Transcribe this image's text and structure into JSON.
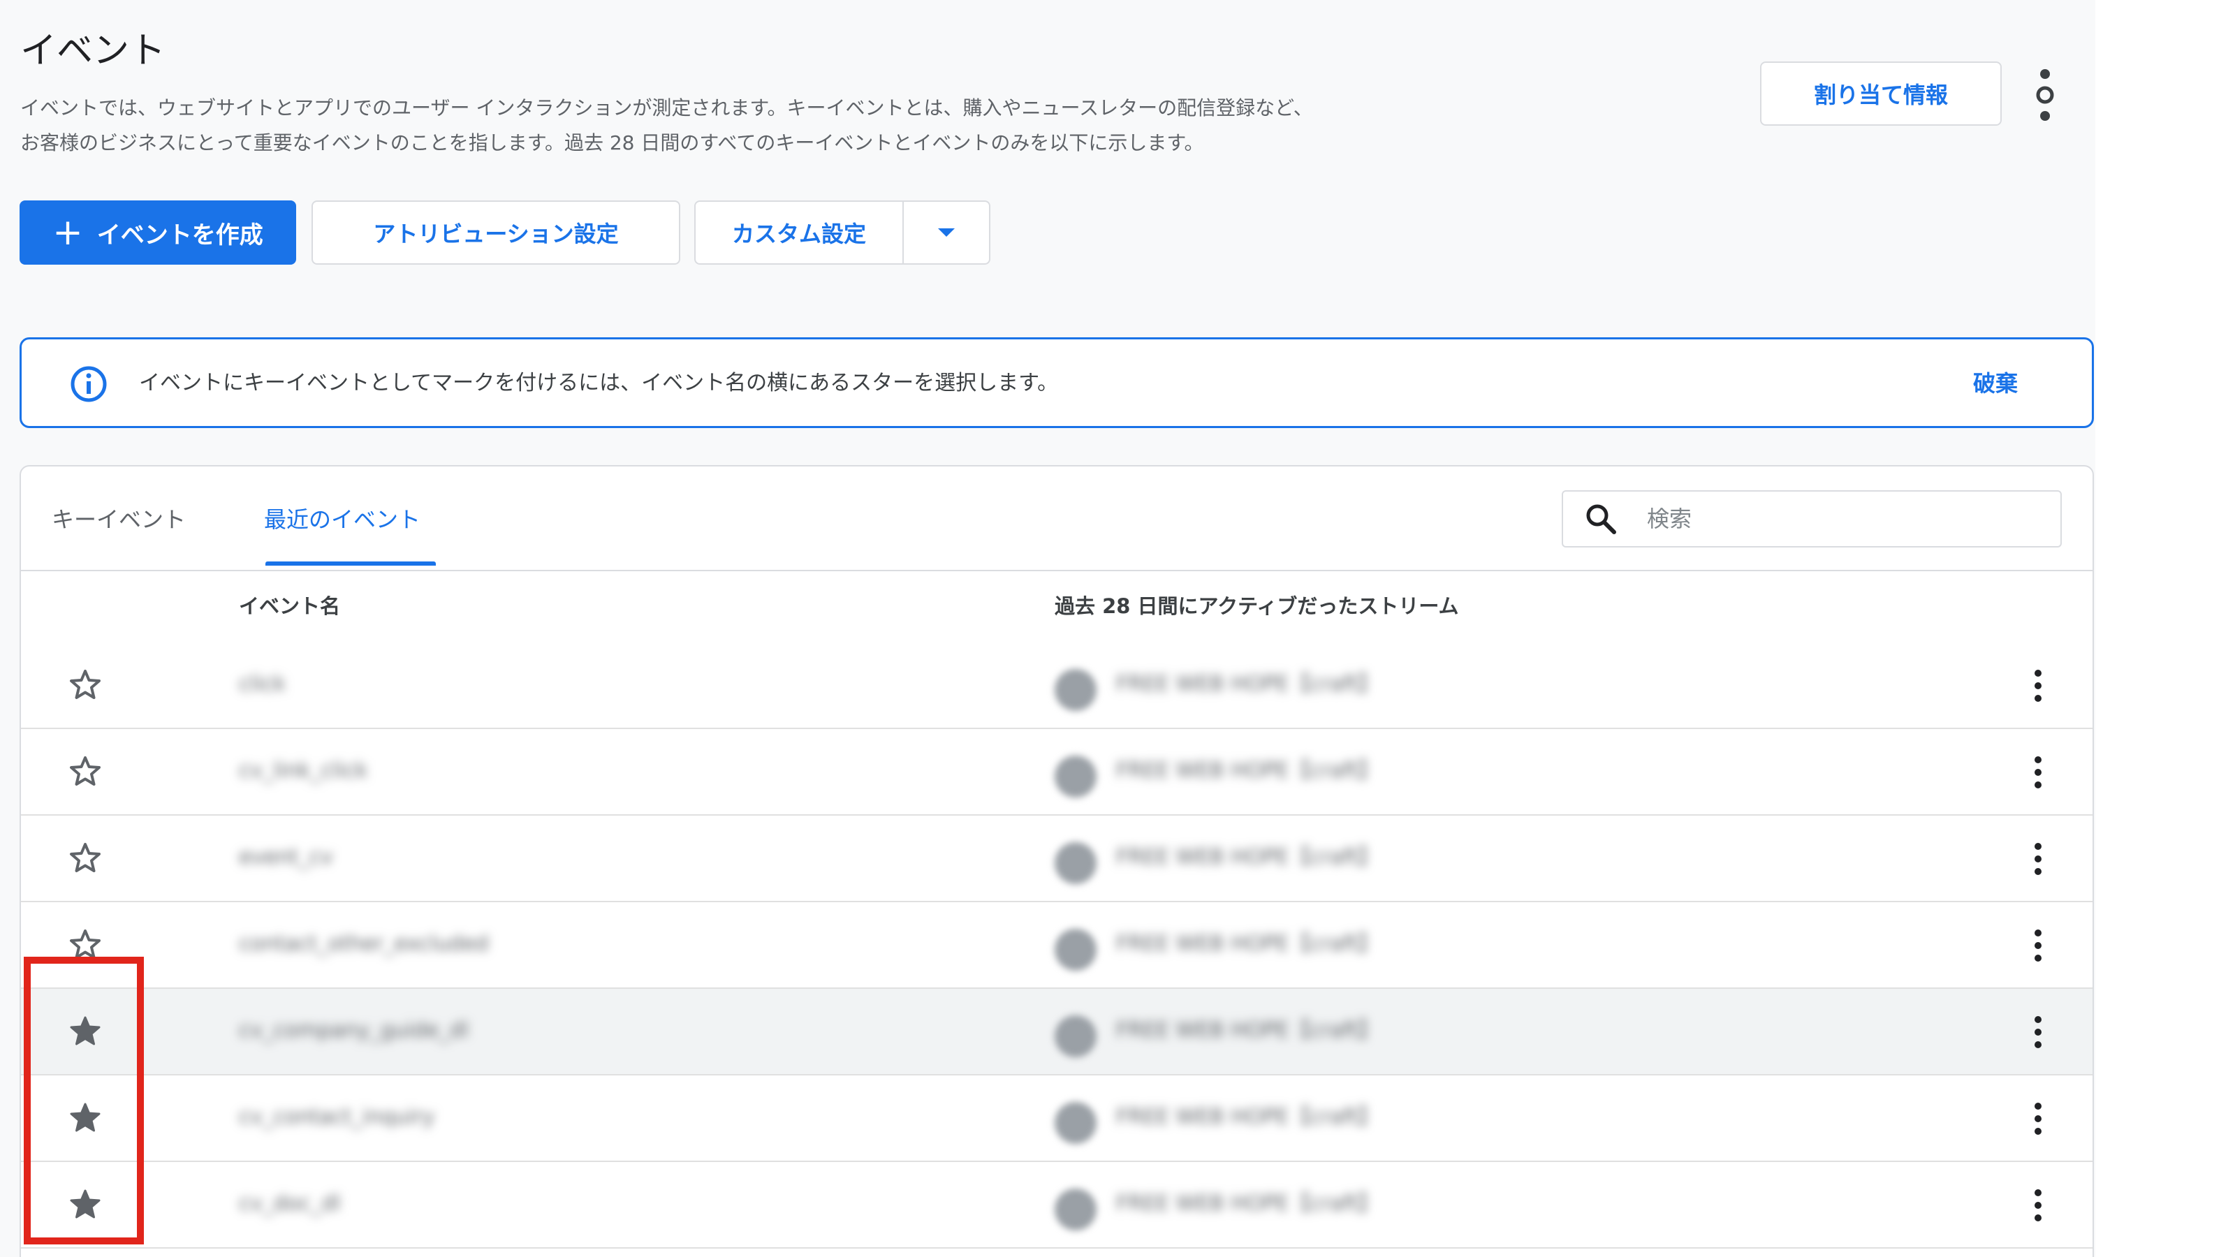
{
  "header": {
    "title": "イベント",
    "description_line1": "イベントでは、ウェブサイトとアプリでのユーザー インタラクションが測定されます。キーイベントとは、購入やニュースレターの配信登録など、",
    "description_line2": "お客様のビジネスにとって重要なイベントのことを指します。過去 28 日間のすべてのキーイベントとイベントのみを以下に示します。",
    "attribution_info_button": "割り当て情報",
    "more_icon": "vertical-dots-icon"
  },
  "toolbar": {
    "create_event_label": "イベントを作成",
    "create_event_icon": "plus-icon",
    "attribution_settings_label": "アトリビューション設定",
    "custom_settings_label": "カスタム設定",
    "custom_dropdown_icon": "caret-down-icon"
  },
  "banner": {
    "icon": "info-icon",
    "text": "イベントにキーイベントとしてマークを付けるには、イベント名の横にあるスターを選択します。",
    "dismiss_label": "破棄"
  },
  "card": {
    "tabs": [
      {
        "label": "キーイベント",
        "active": false
      },
      {
        "label": "最近のイベント",
        "active": true
      }
    ],
    "search": {
      "placeholder": "検索",
      "value": ""
    },
    "columns": {
      "star": "",
      "event_name": "イベント名",
      "stream": "過去 28 日間にアクティブだったストリーム"
    },
    "rows": [
      {
        "starred": false,
        "event_name": "click",
        "stream": "FREE WEB HOPE【craft】",
        "highlighted": false
      },
      {
        "starred": false,
        "event_name": "cv_link_click",
        "stream": "FREE WEB HOPE【craft】",
        "highlighted": false
      },
      {
        "starred": false,
        "event_name": "event_cv",
        "stream": "FREE WEB HOPE【craft】",
        "highlighted": false
      },
      {
        "starred": false,
        "event_name": "contact_other_excluded",
        "stream": "FREE WEB HOPE【craft】",
        "highlighted": false
      },
      {
        "starred": true,
        "event_name": "cv_company_guide_dl",
        "stream": "FREE WEB HOPE【craft】",
        "highlighted": true
      },
      {
        "starred": true,
        "event_name": "cv_contact_inquiry",
        "stream": "FREE WEB HOPE【craft】",
        "highlighted": false
      },
      {
        "starred": true,
        "event_name": "cv_doc_dl",
        "stream": "FREE WEB HOPE【craft】",
        "highlighted": false
      }
    ]
  },
  "colors": {
    "accent": "#1a73e8",
    "annotation_box": "#e1251b",
    "star": "#5f6368"
  }
}
